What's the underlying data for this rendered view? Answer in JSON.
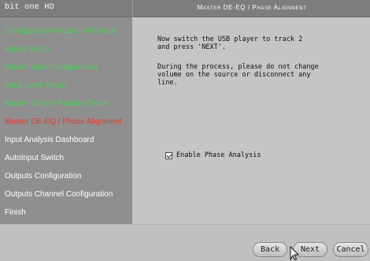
{
  "header": {
    "app_title": "bit one HD",
    "page_title": "Master DE-EQ / Phase Alignment"
  },
  "sidebar": {
    "items": [
      {
        "label": "Configuration Wizard - IIR Mode",
        "state": "done"
      },
      {
        "label": "Inputs Setup",
        "state": "done"
      },
      {
        "label": "Master Input Configuration",
        "state": "done"
      },
      {
        "label": "Input Level Setup",
        "state": "done"
      },
      {
        "label": "Master Delay / Polarity Check",
        "state": "done"
      },
      {
        "label": "Master DE-EQ / Phase Alignment",
        "state": "current"
      },
      {
        "label": "Input Analysis Dashboard",
        "state": "pending"
      },
      {
        "label": "AutoInput Switch",
        "state": "pending"
      },
      {
        "label": "Outputs Configuration",
        "state": "pending"
      },
      {
        "label": "Outputs Channel Configuration",
        "state": "pending"
      },
      {
        "label": "Finish",
        "state": "pending"
      }
    ]
  },
  "content": {
    "instruction_line1": "Now switch the USB player to track 2",
    "instruction_line2": "and press 'NEXT'.",
    "warning_line1": "During the process, please do not change",
    "warning_line2": "volume on the source or disconnect any",
    "warning_line3": "line.",
    "checkbox_label": "Enable Phase Analysis",
    "checkbox_checked": true
  },
  "footer": {
    "back_label": "Back",
    "next_label": "Next",
    "cancel_label": "Cancel"
  },
  "colors": {
    "done": "#4fd05a",
    "current": "#e53a30",
    "pending": "#ffffff"
  }
}
